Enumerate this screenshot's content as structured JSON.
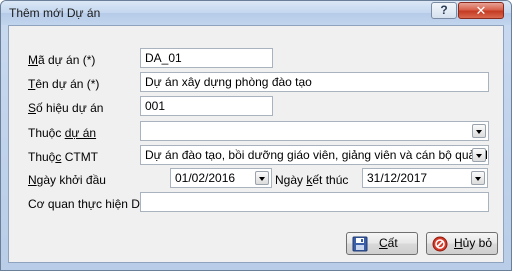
{
  "window": {
    "title": "Thêm mới Dự án",
    "help_label": "?",
    "close_label": "✕"
  },
  "form": {
    "ma_du_an": {
      "label_pre": "",
      "label_u": "M",
      "label_post": "ã dự án (*)",
      "value": "DA_01"
    },
    "ten_du_an": {
      "label_pre": "",
      "label_u": "T",
      "label_post": "ên dự án (*)",
      "value": "Dự án xây dựng phòng đào tạo"
    },
    "so_hieu": {
      "label_pre": "",
      "label_u": "S",
      "label_post": "ố hiệu dự án",
      "value": "001"
    },
    "thuoc_du_an": {
      "label_pre": "Thuộc ",
      "label_u": "dự án",
      "label_post": "",
      "value": ""
    },
    "thuoc_ctmt": {
      "label_pre": "Thuộ",
      "label_u": "c",
      "label_post": " CTMT",
      "value": "Dự án đào tạo, bồi dưỡng giáo viên, giảng viên và cán bộ quản lý cơ"
    },
    "ngay_khoi_dau": {
      "label_pre": "",
      "label_u": "N",
      "label_post": "gày khởi đầu",
      "value": "01/02/2016"
    },
    "ngay_ket_thuc": {
      "label_pre": "Ngày ",
      "label_u": "k",
      "label_post": "ết thúc",
      "value": "31/12/2017"
    },
    "co_quan": {
      "label_pre": "Cơ quan thực hiện D",
      "label_u": "A",
      "label_post": "",
      "value": ""
    }
  },
  "buttons": {
    "cat": {
      "label_u": "C",
      "label_post": "ất"
    },
    "huy_bo": {
      "label_u": "H",
      "label_post": "ủy bỏ"
    }
  }
}
